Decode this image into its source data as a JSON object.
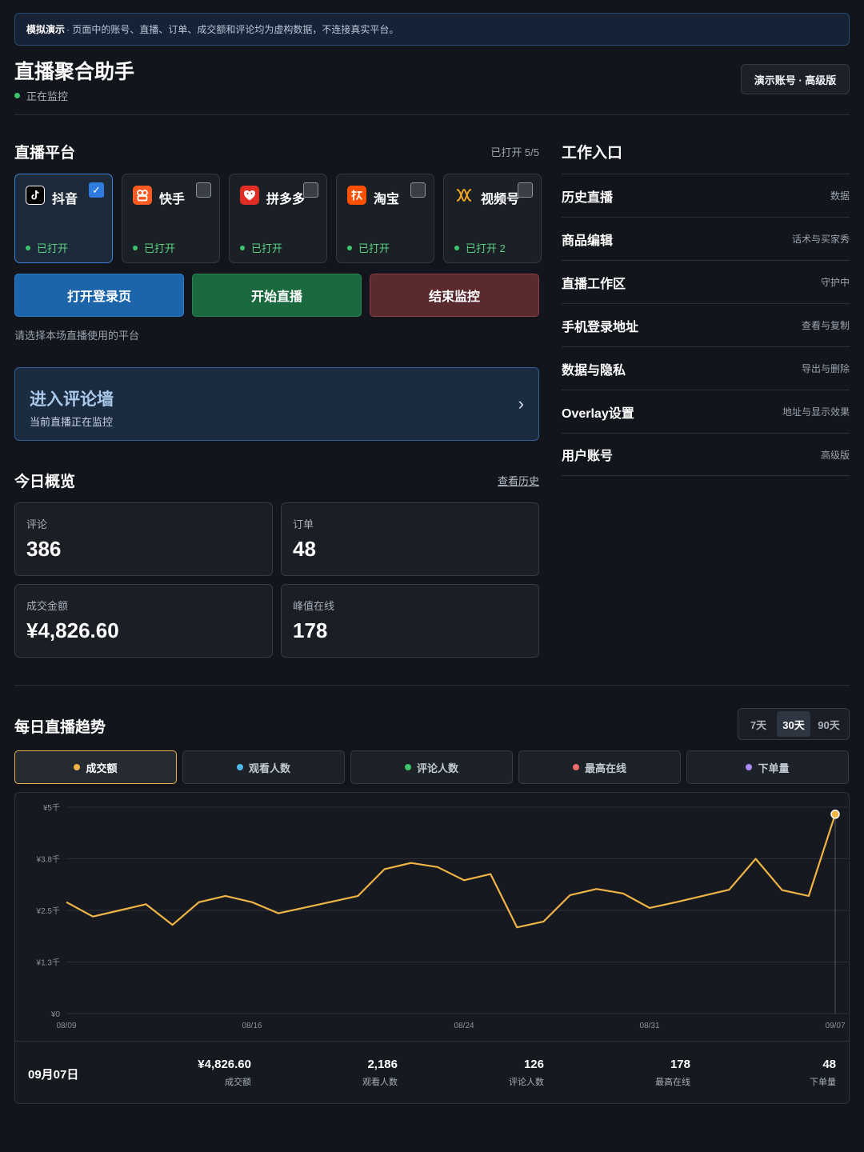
{
  "banner": {
    "strong": "模拟演示",
    "text": " · 页面中的账号、直播、订单、成交额和评论均为虚构数据，不连接真实平台。"
  },
  "header": {
    "title": "直播聚合助手",
    "status": "正在监控",
    "account_badge": "演示账号 · 高级版"
  },
  "platforms": {
    "title": "直播平台",
    "count": "已打开 5/5",
    "items": [
      {
        "name": "抖音",
        "icon": "douyin-icon",
        "logo_color": "#000000",
        "status": "已打开",
        "checked": true
      },
      {
        "name": "快手",
        "icon": "kuaishou-icon",
        "logo_color": "#ff5a1f",
        "status": "已打开",
        "checked": false
      },
      {
        "name": "拼多多",
        "icon": "pinduoduo-icon",
        "logo_color": "#e02e24",
        "status": "已打开",
        "checked": false
      },
      {
        "name": "淘宝",
        "icon": "taobao-icon",
        "logo_color": "#ff5000",
        "status": "已打开",
        "checked": false
      },
      {
        "name": "视频号",
        "icon": "channels-icon",
        "logo_color": "#f5a623",
        "status": "已打开 2",
        "checked": false
      }
    ],
    "hint": "请选择本场直播使用的平台"
  },
  "actions": {
    "open_login": "打开登录页",
    "start_live": "开始直播",
    "stop_monitor": "结束监控"
  },
  "comment_wall": {
    "title": "进入评论墙",
    "subtitle": "当前直播正在监控",
    "arrow": "›"
  },
  "overview": {
    "title": "今日概览",
    "history_link": "查看历史",
    "stats": [
      {
        "label": "评论",
        "value": "386"
      },
      {
        "label": "订单",
        "value": "48"
      },
      {
        "label": "成交金额",
        "value": "¥4,826.60"
      },
      {
        "label": "峰值在线",
        "value": "178"
      }
    ]
  },
  "entries": {
    "title": "工作入口",
    "items": [
      {
        "label": "历史直播",
        "desc": "数据"
      },
      {
        "label": "商品编辑",
        "desc": "话术与买家秀"
      },
      {
        "label": "直播工作区",
        "desc": "守护中"
      },
      {
        "label": "手机登录地址",
        "desc": "查看与复制"
      },
      {
        "label": "数据与隐私",
        "desc": "导出与删除"
      },
      {
        "label": "Overlay设置",
        "desc": "地址与显示效果"
      },
      {
        "label": "用户账号",
        "desc": "高级版"
      }
    ]
  },
  "trend": {
    "title": "每日直播趋势",
    "ranges": [
      "7天",
      "30天",
      "90天"
    ],
    "active_range": "30天",
    "metrics": [
      {
        "label": "成交额",
        "color": "#f0b445"
      },
      {
        "label": "观看人数",
        "color": "#4fb8e6"
      },
      {
        "label": "评论人数",
        "color": "#3ec46d"
      },
      {
        "label": "最高在线",
        "color": "#f06a6a"
      },
      {
        "label": "下单量",
        "color": "#a78bfa"
      }
    ],
    "active_metric": "成交额",
    "summary": {
      "date": "09月07日",
      "items": [
        {
          "value": "¥4,826.60",
          "label": "成交额"
        },
        {
          "value": "2,186",
          "label": "观看人数"
        },
        {
          "value": "126",
          "label": "评论人数"
        },
        {
          "value": "178",
          "label": "最高在线"
        },
        {
          "value": "48",
          "label": "下单量"
        }
      ]
    }
  },
  "chart_data": {
    "type": "line",
    "title": "",
    "xlabel": "",
    "ylabel": "",
    "color": "#f0b445",
    "x_ticks": [
      "08/09",
      "08/16",
      "08/24",
      "08/31",
      "09/07"
    ],
    "y_ticks": [
      "¥0",
      "¥1.3千",
      "¥2.5千",
      "¥3.8千",
      "¥5千"
    ],
    "ylim": [
      0,
      5000
    ],
    "grid": true,
    "x": [
      "08/09",
      "08/10",
      "08/11",
      "08/12",
      "08/13",
      "08/14",
      "08/15",
      "08/16",
      "08/17",
      "08/18",
      "08/19",
      "08/20",
      "08/21",
      "08/22",
      "08/23",
      "08/24",
      "08/25",
      "08/26",
      "08/27",
      "08/28",
      "08/29",
      "08/30",
      "08/31",
      "09/01",
      "09/02",
      "09/03",
      "09/04",
      "09/05",
      "09/06",
      "09/07"
    ],
    "values": [
      2700,
      2350,
      2500,
      2650,
      2150,
      2700,
      2850,
      2700,
      2430,
      2570,
      2710,
      2850,
      3500,
      3650,
      3550,
      3230,
      3380,
      2090,
      2230,
      2870,
      3020,
      2910,
      2560,
      2700,
      2850,
      3000,
      3750,
      2990,
      2850,
      4830
    ]
  }
}
